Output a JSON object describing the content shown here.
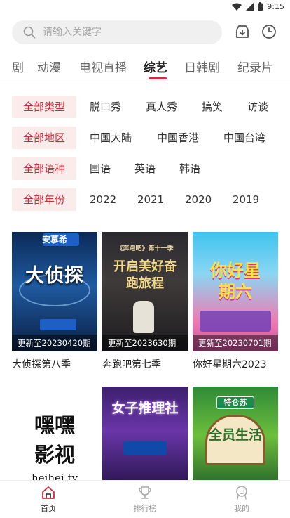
{
  "status": {
    "time": "9:15"
  },
  "search": {
    "placeholder": "请输入关键字"
  },
  "tabs": [
    {
      "label": "剧"
    },
    {
      "label": "动漫"
    },
    {
      "label": "电视直播"
    },
    {
      "label": "综艺",
      "active": true
    },
    {
      "label": "日韩剧"
    },
    {
      "label": "纪录片"
    }
  ],
  "filters": [
    {
      "selected": "全部类型",
      "options": [
        "脱口秀",
        "真人秀",
        "搞笑",
        "访谈"
      ]
    },
    {
      "selected": "全部地区",
      "options": [
        "中国大陆",
        "中国香港",
        "中国台湾"
      ]
    },
    {
      "selected": "全部语种",
      "options": [
        "国语",
        "英语",
        "韩语"
      ]
    },
    {
      "selected": "全部年份",
      "options": [
        "2022",
        "2021",
        "2020",
        "2019"
      ]
    }
  ],
  "cards": [
    {
      "title": "大侦探第八季",
      "update": "更新至20230420期",
      "poster_text": "大侦探",
      "poster_sub": "安慕希"
    },
    {
      "title": "奔跑吧第七季",
      "update": "更新至2023630期",
      "poster_text": "开启美好奋跑旅程",
      "poster_sub": "《奔跑吧》第十一季"
    },
    {
      "title": "你好星期六2023",
      "update": "更新至20230701期",
      "poster_text": "你好星期六",
      "poster_sub": ""
    },
    {
      "title": "",
      "update": "",
      "poster_text": "嘿嘿影视",
      "poster_sub": "heihei.tv"
    },
    {
      "title": "",
      "update": "",
      "poster_text": "女子推理社",
      "poster_sub": ""
    },
    {
      "title": "",
      "update": "",
      "poster_text": "全员生活",
      "poster_sub": "特仑苏"
    }
  ],
  "nav": [
    {
      "label": "首页",
      "icon": "home-icon",
      "active": true
    },
    {
      "label": "排行榜",
      "icon": "trophy-icon"
    },
    {
      "label": "我的",
      "icon": "profile-icon"
    }
  ],
  "colors": {
    "accent": "#d42b3a",
    "chip_bg": "#fbecec"
  }
}
